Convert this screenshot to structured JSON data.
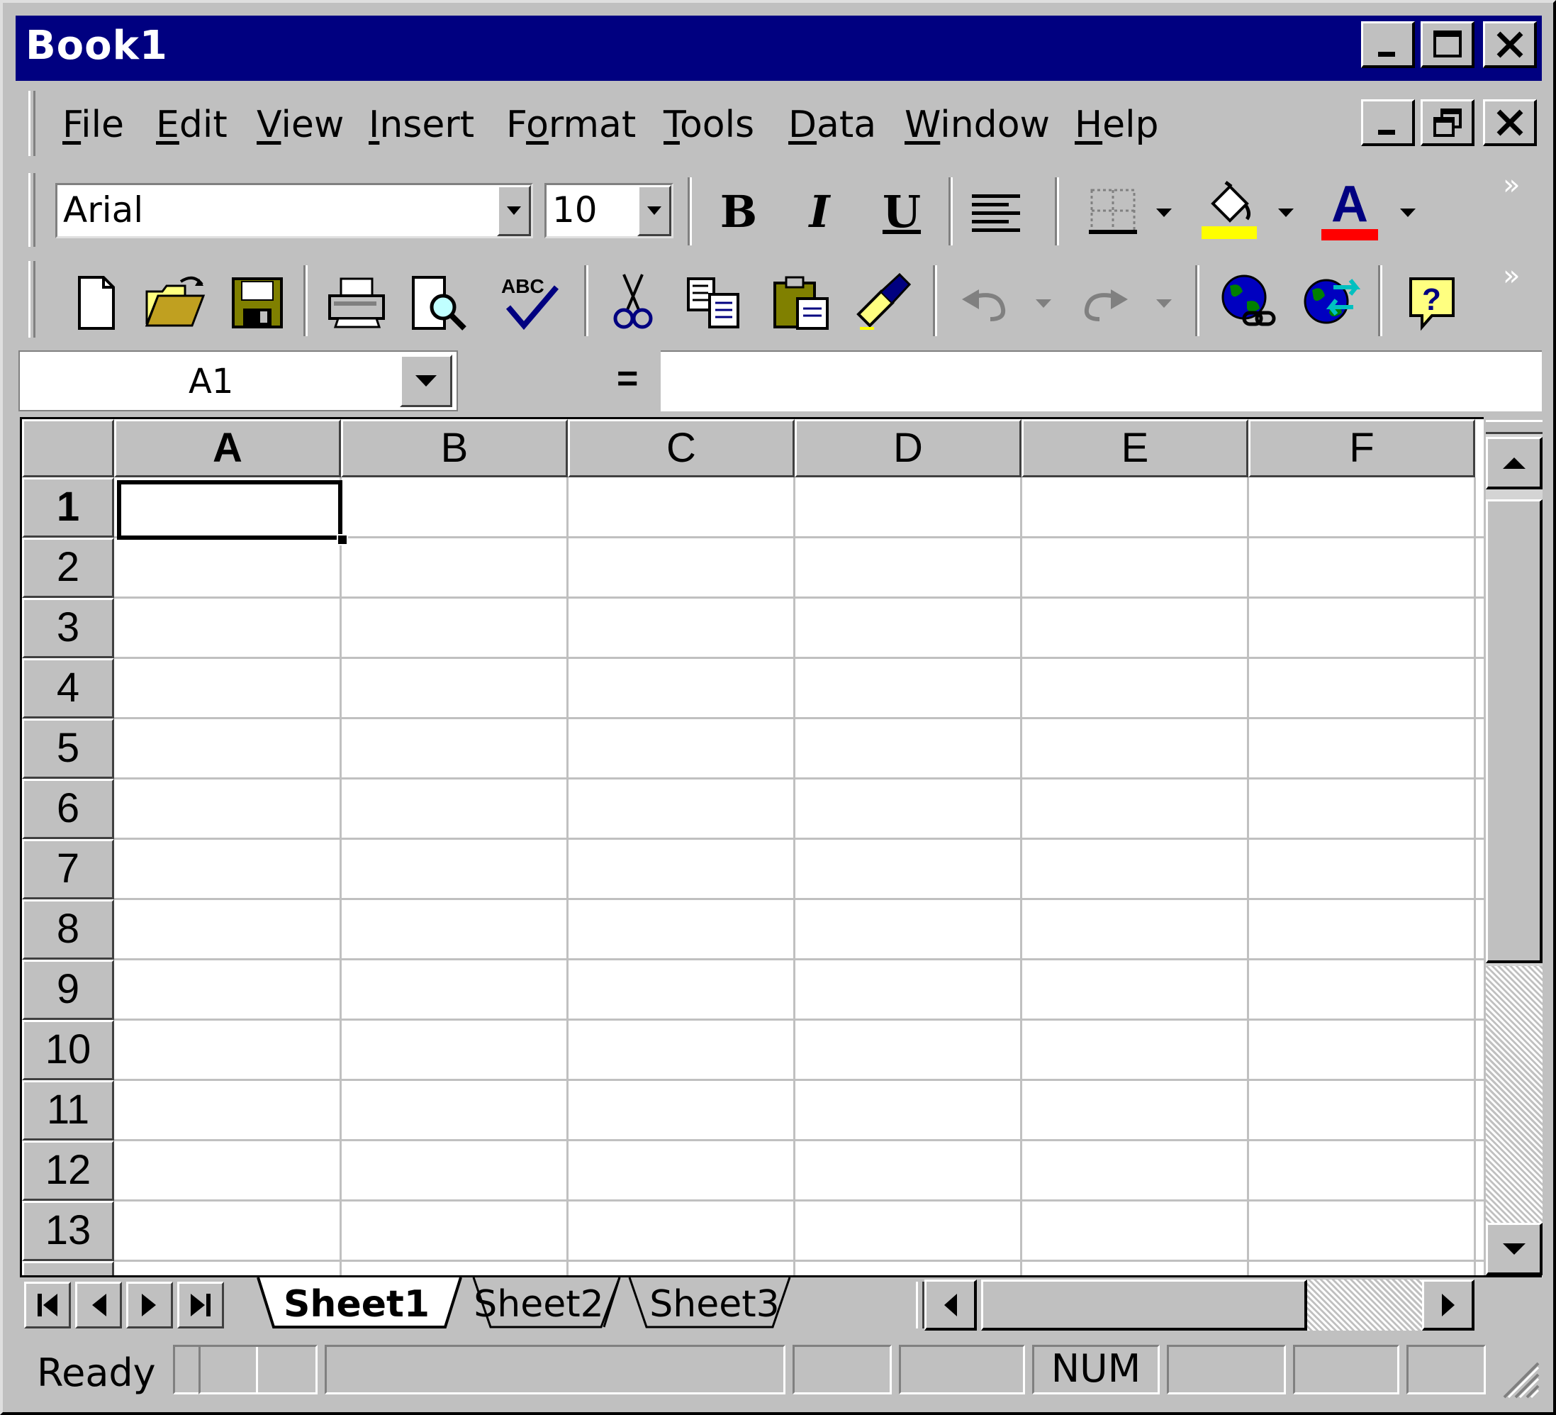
{
  "window": {
    "title": "Book1"
  },
  "menu": {
    "items": [
      {
        "label": "File",
        "key": "F",
        "rest": "ile"
      },
      {
        "label": "Edit",
        "key": "E",
        "rest": "dit"
      },
      {
        "label": "View",
        "key": "V",
        "rest": "iew"
      },
      {
        "label": "Insert",
        "key": "I",
        "rest": "nsert"
      },
      {
        "label": "Format",
        "pre": "F",
        "key": "o",
        "rest": "rmat"
      },
      {
        "label": "Tools",
        "key": "T",
        "rest": "ools"
      },
      {
        "label": "Data",
        "key": "D",
        "rest": "ata"
      },
      {
        "label": "Window",
        "key": "W",
        "rest": "indow"
      },
      {
        "label": "Help",
        "key": "H",
        "rest": "elp"
      }
    ]
  },
  "formatting": {
    "font_name": "Arial",
    "font_size": "10",
    "bold_label": "B",
    "italic_label": "I",
    "underline_label": "U",
    "fill_color": "#ffff00",
    "font_color": "#ff0000",
    "font_color_label": "A",
    "more_label": "»"
  },
  "standard": {
    "more_label": "»"
  },
  "formula_bar": {
    "name_box": "A1",
    "equals": "=",
    "formula": ""
  },
  "grid": {
    "columns": [
      "A",
      "B",
      "C",
      "D",
      "E",
      "F"
    ],
    "rows": [
      "1",
      "2",
      "3",
      "4",
      "5",
      "6",
      "7",
      "8",
      "9",
      "10",
      "11",
      "12",
      "13"
    ],
    "active_cell": "A1"
  },
  "sheets": {
    "tabs": [
      "Sheet1",
      "Sheet2",
      "Sheet3"
    ],
    "active": "Sheet1"
  },
  "status": {
    "text": "Ready",
    "num_indicator": "NUM"
  },
  "colors": {
    "titlebar": "#000080",
    "face": "#c0c0c0"
  }
}
